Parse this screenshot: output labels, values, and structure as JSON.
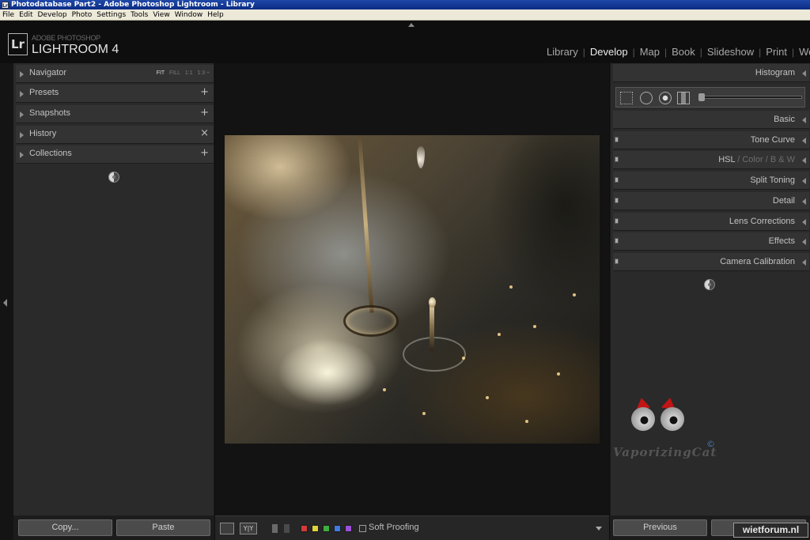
{
  "window": {
    "title": "Photodatabase Part2 - Adobe Photoshop Lightroom - Library",
    "icon_text": "Lr"
  },
  "menubar": {
    "items": [
      "File",
      "Edit",
      "Develop",
      "Photo",
      "Settings",
      "Tools",
      "View",
      "Window",
      "Help"
    ]
  },
  "branding": {
    "logo": "Lr",
    "subtitle": "ADOBE PHOTOSHOP",
    "title": "LIGHTROOM 4"
  },
  "modules": {
    "items": [
      "Library",
      "Develop",
      "Map",
      "Book",
      "Slideshow",
      "Print",
      "We"
    ],
    "active": "Develop",
    "separator": "|"
  },
  "left_panel": {
    "navigator": {
      "label": "Navigator",
      "options": [
        "FIT",
        "FILL",
        "1:1",
        "1:3 ÷"
      ],
      "active_option": "FIT"
    },
    "presets": {
      "label": "Presets",
      "action": "+"
    },
    "snapshots": {
      "label": "Snapshots",
      "action": "+"
    },
    "history": {
      "label": "History",
      "action": "×"
    },
    "collections": {
      "label": "Collections",
      "action": "+"
    },
    "copy_button": "Copy...",
    "paste_button": "Paste"
  },
  "toolbar": {
    "view_icon": "loupe-view-icon",
    "compare_icon": "before-after-icon",
    "compare_label": "Y|Y",
    "color_labels": [
      "#d53a3a",
      "#e0d23a",
      "#3fae3f",
      "#3f7ae0",
      "#9c4fd8"
    ],
    "soft_proofing_label": "Soft Proofing"
  },
  "right_panel": {
    "histogram": "Histogram",
    "basic": "Basic",
    "tone_curve": "Tone Curve",
    "hsl": {
      "a": "HSL",
      "sep1": " / ",
      "b": "Color",
      "sep2": " / ",
      "c": "B & W"
    },
    "split_toning": "Split Toning",
    "detail": "Detail",
    "lens_corrections": "Lens Corrections",
    "effects": "Effects",
    "camera_calibration": "Camera Calibration",
    "previous_button": "Previous"
  },
  "watermark": {
    "text": "VaporizingCat",
    "copyright": "©",
    "badge": "wietforum.nl"
  }
}
